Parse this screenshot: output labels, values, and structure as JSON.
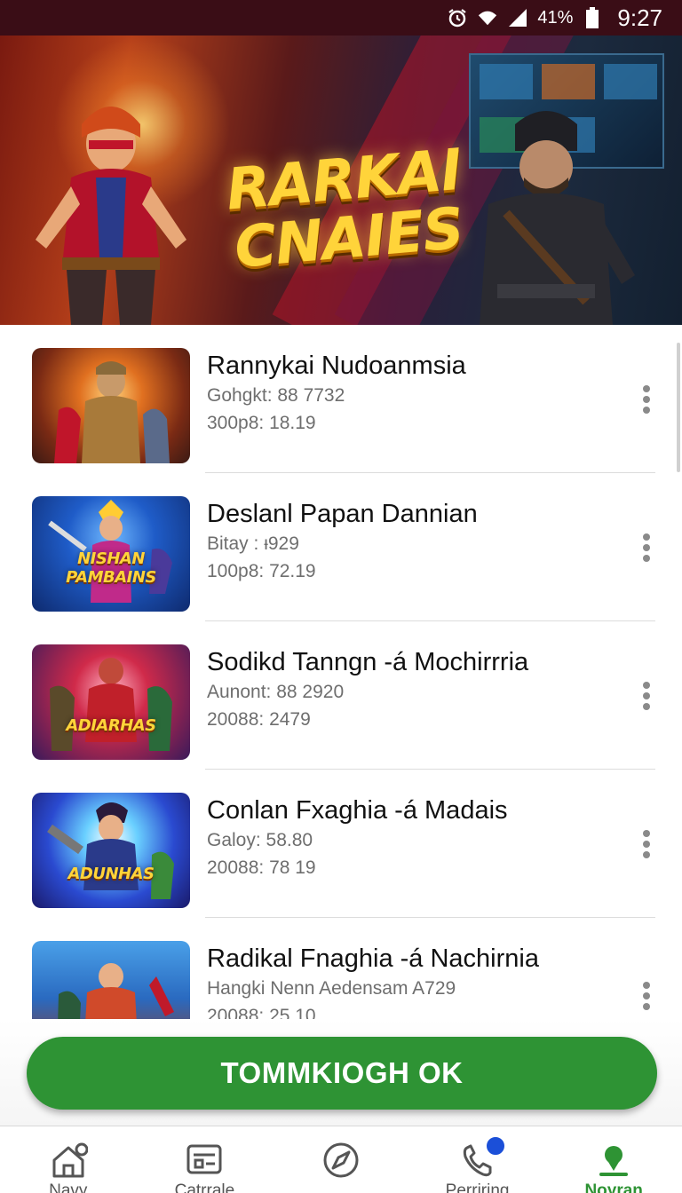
{
  "status_bar": {
    "battery_text": "41%",
    "time": "9:27",
    "icons": [
      "alarm-icon",
      "wifi-icon",
      "signal-icon",
      "battery-icon"
    ]
  },
  "hero": {
    "title_line1": "RARKAI",
    "title_line2": "CNAIES",
    "dots_total": 3,
    "dots_active": 2
  },
  "games": [
    {
      "title": "Rannykai Nudoanmsia",
      "line1": "Gohgkt: 88 7732",
      "line2": "300p8: 18.19",
      "thumb_text": ""
    },
    {
      "title": "Deslanl Papan Dannian",
      "line1": "Bitay : ᵻ929",
      "line2": "100p8: 72.19",
      "thumb_text": "NISHAN PAMBAINS"
    },
    {
      "title": "Sodikd Tanngn -á Mochirrria",
      "line1": "Aunont: 88 2920",
      "line2": "20088: 2479",
      "thumb_text": "ADIARHAS"
    },
    {
      "title": "Conlan Fxaghia -á Madais",
      "line1": "Galoy: 58.80",
      "line2": "20088: 78 19",
      "thumb_text": "ADUNHAS"
    },
    {
      "title": "Radikal Fnaghia -á Nachirnia",
      "line1": "Hangki Nenn Aedensam A729",
      "line2": "20088: 25.10",
      "thumb_text": ""
    }
  ],
  "cta": {
    "label": "TOMMKIOGH OK"
  },
  "nav": [
    {
      "label": "Navy",
      "icon": "home-icon"
    },
    {
      "label": "Catrrale",
      "icon": "catalog-icon"
    },
    {
      "label": "",
      "icon": "compass-icon"
    },
    {
      "label": "Perriring",
      "icon": "phone-icon"
    },
    {
      "label": "Noyran",
      "icon": "profile-pin-icon"
    }
  ],
  "colors": {
    "status_bg": "#3a0d16",
    "accent_green": "#2e9334",
    "badge_blue": "#1b4fd8"
  }
}
